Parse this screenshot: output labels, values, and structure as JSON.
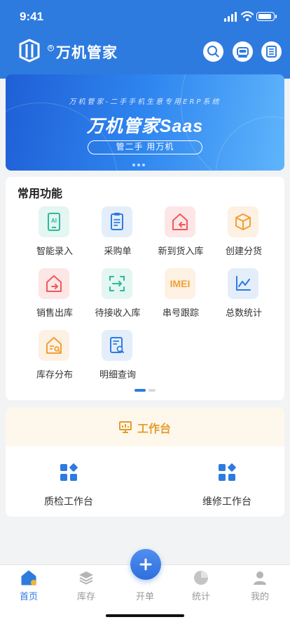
{
  "status_bar": {
    "time": "9:41"
  },
  "header": {
    "app_title": "万机管家",
    "icons": [
      "search-icon",
      "robot-icon",
      "document-list-icon"
    ]
  },
  "banner": {
    "subtitle": "万机管家-二手手机生意专用ERP系统",
    "title": "万机管家Saas",
    "slogan": "管二手  用万机",
    "slide_count": 3
  },
  "functions": {
    "title": "常用功能",
    "items": [
      {
        "label": "智能录入",
        "icon": "ai-tablet-icon",
        "color": "#2fb89b",
        "bg": "#e3f6f1"
      },
      {
        "label": "采购单",
        "icon": "clipboard-icon",
        "color": "#2e7be0",
        "bg": "#e4eefb"
      },
      {
        "label": "新到货入库",
        "icon": "house-return-icon",
        "color": "#ef5a5a",
        "bg": "#fde6e6"
      },
      {
        "label": "创建分货",
        "icon": "box-icon",
        "color": "#f0a035",
        "bg": "#fdf1e3"
      },
      {
        "label": "销售出库",
        "icon": "house-export-icon",
        "color": "#ef5a5a",
        "bg": "#fde6e6"
      },
      {
        "label": "待接收入库",
        "icon": "scan-arrow-icon",
        "color": "#2fb89b",
        "bg": "#e3f6f1"
      },
      {
        "label": "串号跟踪",
        "icon": "imei-icon",
        "icon_text": "IMEI",
        "color": "#f0a035",
        "bg": "#fdf1e3"
      },
      {
        "label": "总数统计",
        "icon": "line-chart-icon",
        "color": "#2e7be0",
        "bg": "#e4eefb"
      },
      {
        "label": "库存分布",
        "icon": "house-search-icon",
        "color": "#f0a035",
        "bg": "#fdf1e3"
      },
      {
        "label": "明细查询",
        "icon": "doc-search-icon",
        "color": "#2e7be0",
        "bg": "#e4eefb"
      }
    ],
    "page_count": 2,
    "current_page": 1
  },
  "workspace": {
    "title": "工作台",
    "icon": "presentation-board-icon",
    "items": [
      {
        "label": "质检工作台",
        "icon": "apps-grid-icon"
      },
      {
        "label": "维修工作台",
        "icon": "apps-grid-icon"
      }
    ]
  },
  "tabbar": {
    "items": [
      {
        "label": "首页",
        "icon": "home-icon",
        "active": true
      },
      {
        "label": "库存",
        "icon": "layers-icon",
        "active": false
      },
      {
        "label": "开单",
        "icon": "plus-icon",
        "active": false
      },
      {
        "label": "统计",
        "icon": "pie-chart-icon",
        "active": false
      },
      {
        "label": "我的",
        "icon": "user-icon",
        "active": false
      }
    ]
  },
  "colors": {
    "primary": "#2e7be0",
    "workspace_accent": "#e69b2c",
    "inactive_tab": "#999999"
  }
}
